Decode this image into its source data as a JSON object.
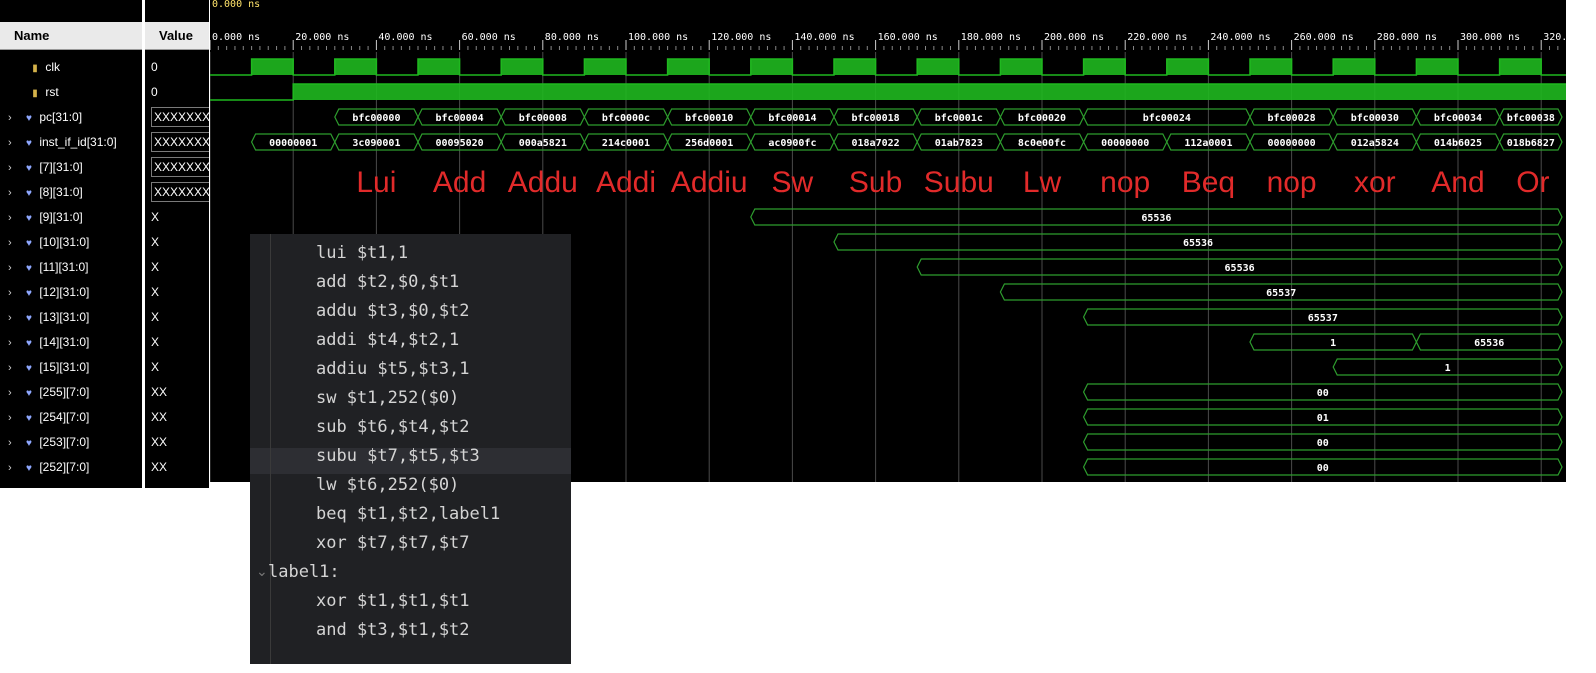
{
  "header": {
    "name_col": "Name",
    "value_col": "Value",
    "cursor_time": "0.000 ns"
  },
  "signals": [
    {
      "name": "clk",
      "value": "0",
      "type": "bit"
    },
    {
      "name": "rst",
      "value": "0",
      "type": "bit"
    },
    {
      "name": "pc[31:0]",
      "value": "XXXXXXXX",
      "type": "bus"
    },
    {
      "name": "inst_if_id[31:0]",
      "value": "XXXXXXXX",
      "type": "bus"
    },
    {
      "name": "[7][31:0]",
      "value": "XXXXXXXX",
      "type": "bus"
    },
    {
      "name": "[8][31:0]",
      "value": "XXXXXXXX",
      "type": "bus"
    },
    {
      "name": "[9][31:0]",
      "value": "X",
      "type": "bus"
    },
    {
      "name": "[10][31:0]",
      "value": "X",
      "type": "bus"
    },
    {
      "name": "[11][31:0]",
      "value": "X",
      "type": "bus"
    },
    {
      "name": "[12][31:0]",
      "value": "X",
      "type": "bus"
    },
    {
      "name": "[13][31:0]",
      "value": "X",
      "type": "bus"
    },
    {
      "name": "[14][31:0]",
      "value": "X",
      "type": "bus"
    },
    {
      "name": "[15][31:0]",
      "value": "X",
      "type": "bus"
    },
    {
      "name": "[255][7:0]",
      "value": "XX",
      "type": "bus"
    },
    {
      "name": "[254][7:0]",
      "value": "XX",
      "type": "bus"
    },
    {
      "name": "[253][7:0]",
      "value": "XX",
      "type": "bus"
    },
    {
      "name": "[252][7:0]",
      "value": "XX",
      "type": "bus"
    }
  ],
  "time_ticks": [
    "0.000 ns",
    "20.000 ns",
    "40.000 ns",
    "60.000 ns",
    "80.000 ns",
    "100.000 ns",
    "120.000 ns",
    "140.000 ns",
    "160.000 ns",
    "180.000 ns",
    "200.000 ns",
    "220.000 ns",
    "240.000 ns",
    "260.000 ns",
    "280.000 ns",
    "300.000 ns",
    "320.0"
  ],
  "pc_values": [
    {
      "t0": 30,
      "t1": 50,
      "v": "bfc00000"
    },
    {
      "t0": 50,
      "t1": 70,
      "v": "bfc00004"
    },
    {
      "t0": 70,
      "t1": 90,
      "v": "bfc00008"
    },
    {
      "t0": 90,
      "t1": 110,
      "v": "bfc0000c"
    },
    {
      "t0": 110,
      "t1": 130,
      "v": "bfc00010"
    },
    {
      "t0": 130,
      "t1": 150,
      "v": "bfc00014"
    },
    {
      "t0": 150,
      "t1": 170,
      "v": "bfc00018"
    },
    {
      "t0": 170,
      "t1": 190,
      "v": "bfc0001c"
    },
    {
      "t0": 190,
      "t1": 210,
      "v": "bfc00020"
    },
    {
      "t0": 210,
      "t1": 250,
      "v": "bfc00024"
    },
    {
      "t0": 250,
      "t1": 270,
      "v": "bfc00028"
    },
    {
      "t0": 270,
      "t1": 290,
      "v": "bfc00030"
    },
    {
      "t0": 290,
      "t1": 310,
      "v": "bfc00034"
    },
    {
      "t0": 310,
      "t1": 325,
      "v": "bfc00038"
    }
  ],
  "inst_values": [
    {
      "t0": 10,
      "t1": 30,
      "v": "00000001"
    },
    {
      "t0": 30,
      "t1": 50,
      "v": "3c090001"
    },
    {
      "t0": 50,
      "t1": 70,
      "v": "00095020"
    },
    {
      "t0": 70,
      "t1": 90,
      "v": "000a5821"
    },
    {
      "t0": 90,
      "t1": 110,
      "v": "214c0001"
    },
    {
      "t0": 110,
      "t1": 130,
      "v": "256d0001"
    },
    {
      "t0": 130,
      "t1": 150,
      "v": "ac0900fc"
    },
    {
      "t0": 150,
      "t1": 170,
      "v": "018a7022"
    },
    {
      "t0": 170,
      "t1": 190,
      "v": "01ab7823"
    },
    {
      "t0": 190,
      "t1": 210,
      "v": "8c0e00fc"
    },
    {
      "t0": 210,
      "t1": 230,
      "v": "00000000"
    },
    {
      "t0": 230,
      "t1": 250,
      "v": "112a0001"
    },
    {
      "t0": 250,
      "t1": 270,
      "v": "00000000"
    },
    {
      "t0": 270,
      "t1": 290,
      "v": "012a5824"
    },
    {
      "t0": 290,
      "t1": 310,
      "v": "014b6025"
    },
    {
      "t0": 310,
      "t1": 325,
      "v": "018b6827"
    }
  ],
  "register_waves": [
    {
      "row": 6,
      "segments": [
        {
          "t0": 130,
          "t1": 325,
          "v": "65536"
        }
      ]
    },
    {
      "row": 7,
      "segments": [
        {
          "t0": 150,
          "t1": 325,
          "v": "65536"
        }
      ]
    },
    {
      "row": 8,
      "segments": [
        {
          "t0": 170,
          "t1": 325,
          "v": "65536"
        }
      ]
    },
    {
      "row": 9,
      "segments": [
        {
          "t0": 190,
          "t1": 325,
          "v": "65537"
        }
      ]
    },
    {
      "row": 10,
      "segments": [
        {
          "t0": 210,
          "t1": 325,
          "v": "65537"
        }
      ]
    },
    {
      "row": 11,
      "segments": [
        {
          "t0": 250,
          "t1": 290,
          "v": "1"
        },
        {
          "t0": 290,
          "t1": 325,
          "v": "65536"
        }
      ]
    },
    {
      "row": 12,
      "segments": [
        {
          "t0": 270,
          "t1": 325,
          "v": "1"
        }
      ]
    },
    {
      "row": 13,
      "segments": [
        {
          "t0": 210,
          "t1": 325,
          "v": "00"
        }
      ]
    },
    {
      "row": 14,
      "segments": [
        {
          "t0": 210,
          "t1": 325,
          "v": "01"
        }
      ]
    },
    {
      "row": 15,
      "segments": [
        {
          "t0": 210,
          "t1": 325,
          "v": "00"
        }
      ]
    },
    {
      "row": 16,
      "segments": [
        {
          "t0": 210,
          "t1": 325,
          "v": "00"
        }
      ]
    }
  ],
  "annotations": [
    {
      "t": 40,
      "label": "Lui"
    },
    {
      "t": 60,
      "label": "Add"
    },
    {
      "t": 80,
      "label": "Addu"
    },
    {
      "t": 100,
      "label": "Addi"
    },
    {
      "t": 120,
      "label": "Addiu"
    },
    {
      "t": 140,
      "label": "Sw"
    },
    {
      "t": 160,
      "label": "Sub"
    },
    {
      "t": 180,
      "label": "Subu"
    },
    {
      "t": 200,
      "label": "Lw"
    },
    {
      "t": 220,
      "label": "nop"
    },
    {
      "t": 240,
      "label": "Beq"
    },
    {
      "t": 260,
      "label": "nop"
    },
    {
      "t": 280,
      "label": "xor"
    },
    {
      "t": 300,
      "label": "And"
    },
    {
      "t": 318,
      "label": "Or"
    }
  ],
  "code_lines": [
    {
      "text": "lui $t1,1",
      "indent": 1
    },
    {
      "text": "add $t2,$0,$t1",
      "indent": 1
    },
    {
      "text": "addu $t3,$0,$t2",
      "indent": 1
    },
    {
      "text": "addi $t4,$t2,1",
      "indent": 1
    },
    {
      "text": "addiu $t5,$t3,1",
      "indent": 1
    },
    {
      "text": "sw $t1,252($0)",
      "indent": 1
    },
    {
      "text": "sub $t6,$t4,$t2",
      "indent": 1
    },
    {
      "text": "subu $t7,$t5,$t3",
      "indent": 1
    },
    {
      "text": "lw $t6,252($0)",
      "indent": 1
    },
    {
      "text": "beq $t1,$t2,label1",
      "indent": 1
    },
    {
      "text": "xor $t7,$t7,$t7",
      "indent": 1
    },
    {
      "text": "label1:",
      "indent": 0
    },
    {
      "text": "xor $t1,$t1,$t1",
      "indent": 1
    },
    {
      "text": "and $t3,$t1,$t2",
      "indent": 1
    }
  ],
  "colors": {
    "wave_green": "#1fb81f",
    "bus_green": "#2e9d2e",
    "label_red": "#e12a2a",
    "grid": "#4a4a4a",
    "bus_text": "#ffffff"
  }
}
